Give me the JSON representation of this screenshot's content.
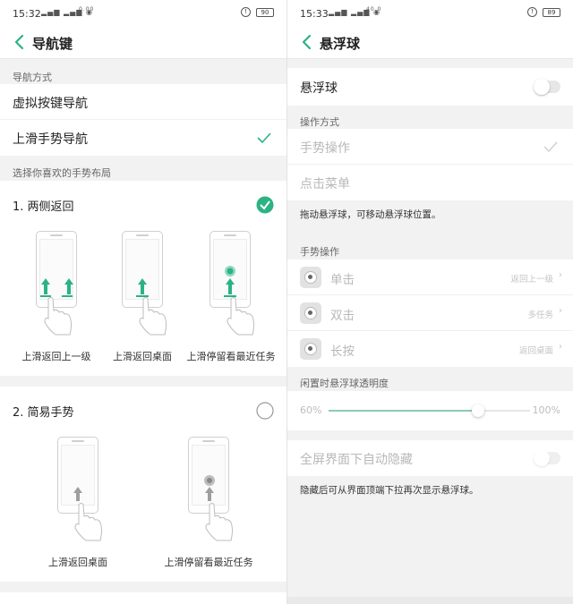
{
  "left_screen": {
    "status": {
      "time": "15:32",
      "signal": "▂▄▆ ▂▄▆ ◉",
      "speed": "0.00",
      "battery": "90"
    },
    "title": "导航键",
    "nav_mode_label": "导航方式",
    "options": [
      {
        "label": "虚拟按键导航",
        "selected": false
      },
      {
        "label": "上滑手势导航",
        "selected": true
      }
    ],
    "layout_label": "选择你喜欢的手势布局",
    "layouts": [
      {
        "title": "1. 两侧返回",
        "selected": true,
        "gestures": [
          "上滑返回上一级",
          "上滑返回桌面",
          "上滑停留看最近任务"
        ]
      },
      {
        "title": "2. 简易手势",
        "selected": false,
        "gestures": [
          "上滑返回桌面",
          "上滑停留看最近任务"
        ]
      }
    ],
    "accent_color": "#2bb383"
  },
  "right_screen": {
    "status": {
      "time": "15:33",
      "signal": "▂▄▆ ▂▄▆ ◉",
      "speed": "40.0",
      "battery": "89"
    },
    "title": "悬浮球",
    "master_toggle": {
      "label": "悬浮球",
      "on": false
    },
    "operation_label": "操作方式",
    "operations": [
      {
        "label": "手势操作",
        "selected": true
      },
      {
        "label": "点击菜单",
        "selected": false
      }
    ],
    "drag_note": "拖动悬浮球，可移动悬浮球位置。",
    "gesture_ops_label": "手势操作",
    "gesture_ops": [
      {
        "label": "单击",
        "value": "返回上一级"
      },
      {
        "label": "双击",
        "value": "多任务"
      },
      {
        "label": "长按",
        "value": "返回桌面"
      }
    ],
    "opacity_label": "闲置时悬浮球透明度",
    "opacity_min": "60%",
    "opacity_max": "100%",
    "opacity_level": 0.74,
    "auto_hide": {
      "label": "全屏界面下自动隐藏",
      "on": false
    },
    "auto_hide_note": "隐藏后可从界面顶端下拉再次显示悬浮球。"
  }
}
